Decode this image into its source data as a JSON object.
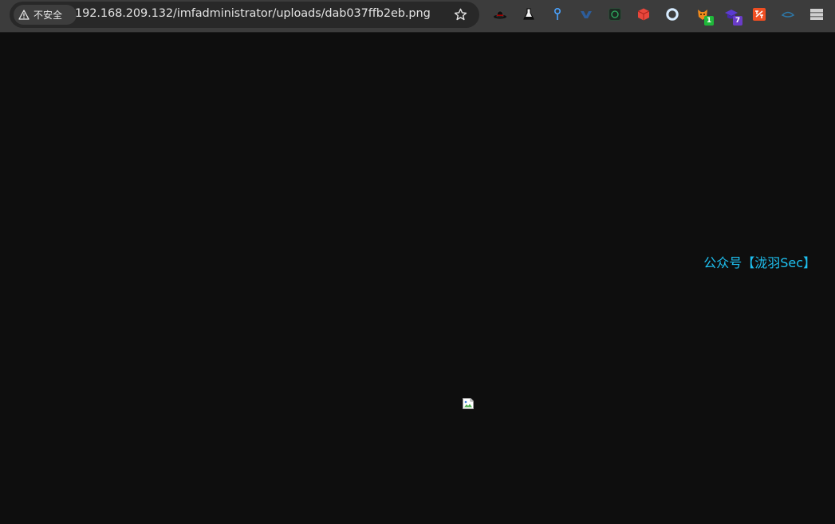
{
  "browser": {
    "security_label": "不安全",
    "url": "192.168.209.132/imfadministrator/uploads/dab037ffb2eb.png",
    "extensions": [
      {
        "name": "hat-icon"
      },
      {
        "name": "flask-icon"
      },
      {
        "name": "pin-icon"
      },
      {
        "name": "wappalyzer-icon"
      },
      {
        "name": "hackbar-icon"
      },
      {
        "name": "package-icon"
      },
      {
        "name": "ring-icon"
      },
      {
        "name": "fox-icon",
        "badge": "1",
        "badge_color": "#1fb83a"
      },
      {
        "name": "cap-icon",
        "badge": "7",
        "badge_color": "#6a3cc8"
      },
      {
        "name": "translate-icon"
      },
      {
        "name": "eye-icon"
      },
      {
        "name": "menu-icon"
      }
    ]
  },
  "page": {
    "watermark": "公众号【泷羽Sec】",
    "watermark_color": "#1ec0f0"
  },
  "colors": {
    "background": "#0e0e0e",
    "toolbar": "#3c3c3c",
    "omnibox": "#282828"
  }
}
